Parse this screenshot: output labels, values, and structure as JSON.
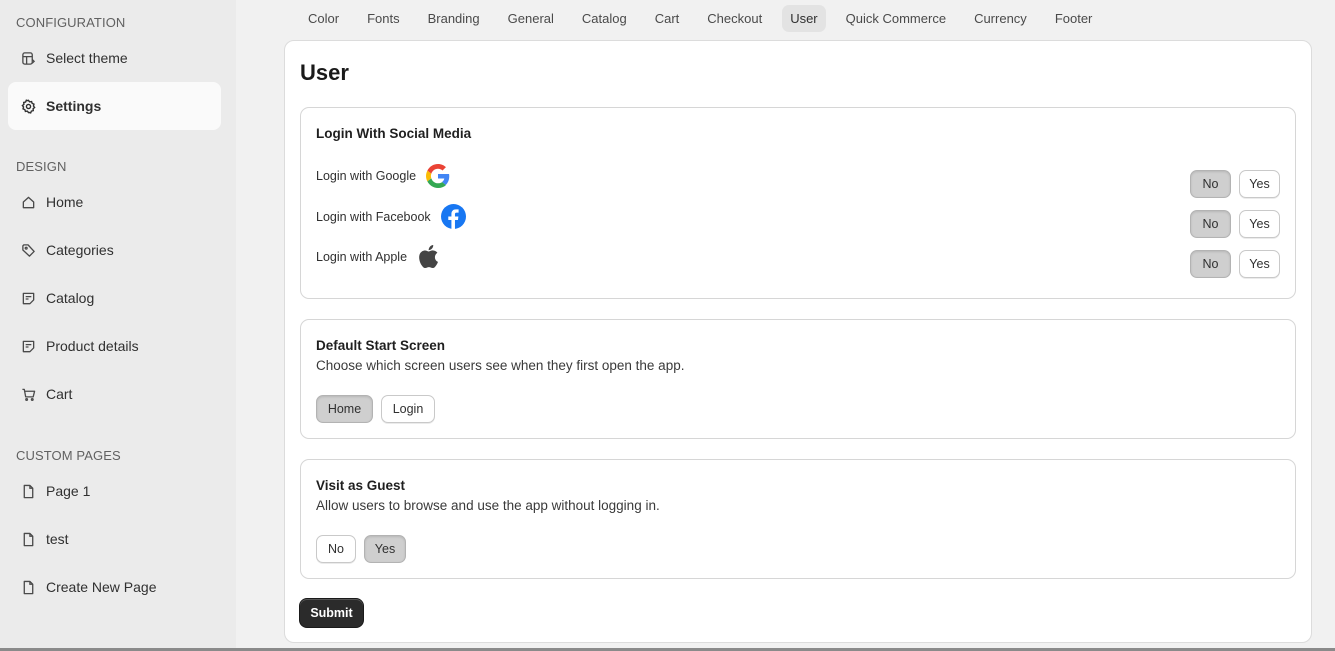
{
  "sidebar": {
    "configuration_label": "CONFIGURATION",
    "design_label": "DESIGN",
    "custom_pages_label": "CUSTOM PAGES",
    "items": [
      {
        "label": "Select theme",
        "icon": "theme-icon"
      },
      {
        "label": "Settings",
        "icon": "gear-icon",
        "active": true
      },
      {
        "label": "Home",
        "icon": "home-icon"
      },
      {
        "label": "Categories",
        "icon": "tag-icon"
      },
      {
        "label": "Catalog",
        "icon": "note-icon"
      },
      {
        "label": "Product details",
        "icon": "note-icon"
      },
      {
        "label": "Cart",
        "icon": "cart-icon"
      },
      {
        "label": "Page 1",
        "icon": "page-icon"
      },
      {
        "label": "test",
        "icon": "page-icon"
      },
      {
        "label": "Create New Page",
        "icon": "page-icon"
      }
    ]
  },
  "tabs": [
    "Color",
    "Fonts",
    "Branding",
    "General",
    "Catalog",
    "Cart",
    "Checkout",
    "User",
    "Quick Commerce",
    "Currency",
    "Footer"
  ],
  "active_tab": "User",
  "page_title": "User",
  "social": {
    "title": "Login With Social Media",
    "rows": [
      {
        "label": "Login with Google",
        "icon": "google-icon",
        "selected": "No"
      },
      {
        "label": "Login with Facebook",
        "icon": "facebook-icon",
        "selected": "No"
      },
      {
        "label": "Login with Apple",
        "icon": "apple-icon",
        "selected": "No"
      }
    ],
    "no_label": "No",
    "yes_label": "Yes"
  },
  "start_screen": {
    "title": "Default Start Screen",
    "description": "Choose which screen users see when they first open the app.",
    "options": [
      "Home",
      "Login"
    ],
    "selected": "Home"
  },
  "guest": {
    "title": "Visit as Guest",
    "description": "Allow users to browse and use the app without logging in.",
    "options": [
      "No",
      "Yes"
    ],
    "selected": "Yes"
  },
  "submit_label": "Submit",
  "colors": {
    "sidebar_bg": "#ebebeb",
    "selected_button": "#cfcfcf",
    "submit_bg": "#2b2b2b",
    "facebook_blue": "#1877f2"
  }
}
